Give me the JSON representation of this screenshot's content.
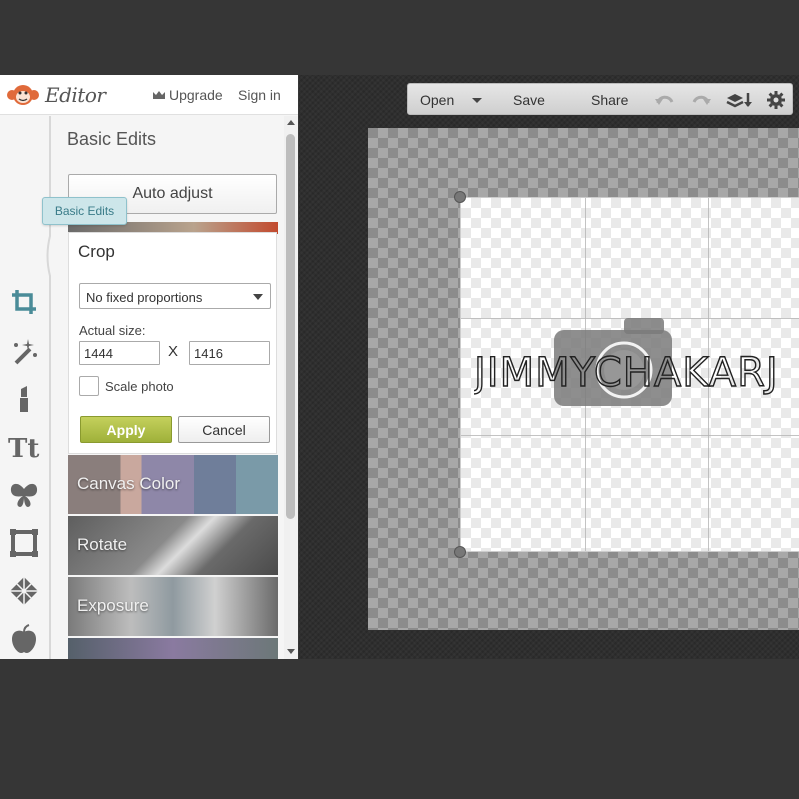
{
  "header": {
    "app_title": "Editor",
    "upgrade_label": "Upgrade",
    "signin_label": "Sign in"
  },
  "tooltip": {
    "text": "Basic Edits"
  },
  "tools": [
    {
      "name": "crop-icon",
      "active": true
    },
    {
      "name": "magic-wand-icon"
    },
    {
      "name": "lipstick-icon"
    },
    {
      "name": "text-icon"
    },
    {
      "name": "butterfly-icon"
    },
    {
      "name": "frame-icon"
    },
    {
      "name": "texture-icon"
    },
    {
      "name": "apple-icon"
    }
  ],
  "panel": {
    "title": "Basic Edits",
    "auto_adjust": "Auto adjust",
    "crop": {
      "title": "Crop",
      "proportion_selected": "No fixed proportions",
      "size_label": "Actual size:",
      "width": "1444",
      "height": "1416",
      "separator": "X",
      "scale_label": "Scale photo",
      "scale_checked": false,
      "apply_label": "Apply",
      "cancel_label": "Cancel"
    },
    "tiles": [
      {
        "label": "Canvas Color"
      },
      {
        "label": "Rotate"
      },
      {
        "label": "Exposure"
      }
    ]
  },
  "topbar": {
    "open_label": "Open",
    "save_label": "Save",
    "share_label": "Share",
    "icons": [
      "undo-icon",
      "redo-icon",
      "layers-icon",
      "gear-icon"
    ]
  },
  "canvas": {
    "artwork_text": "JIMMYCHAKARJ"
  },
  "colors": {
    "accent_blue": "#4a8b98",
    "apply_green": "#9fb13a",
    "workspace_bg": "#2f2f2f",
    "logo_orange": "#e06a3a"
  }
}
